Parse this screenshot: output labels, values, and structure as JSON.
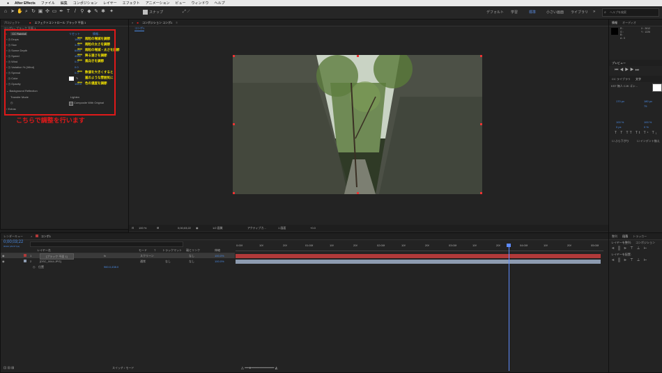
{
  "menubar": {
    "app_name": "After Effects",
    "items": [
      "ファイル",
      "編集",
      "コンポジション",
      "レイヤー",
      "エフェクト",
      "アニメーション",
      "ビュー",
      "ウィンドウ",
      "ヘルプ"
    ]
  },
  "toolbar": {
    "snap_label": "スナップ",
    "workspaces": [
      "デフォルト",
      "学習",
      "標準",
      "小さい画面",
      "ライブラリ"
    ],
    "active_workspace": "標準",
    "help_search_placeholder": "ヘルプを検索"
  },
  "effect_panel": {
    "tabs": [
      "プロジェクト",
      "エフェクトコントロール ブラック 平面 1"
    ],
    "breadcrumb": "コンポ1 • ブラック 平面 1",
    "effect_name": "CC Rainfall",
    "reset_label": "リセット",
    "properties": [
      {
        "label": "Drops",
        "value": "1600",
        "note": "雨粒の増減を調節"
      },
      {
        "label": "Size",
        "value": "3.00",
        "note": "雨粒の太さを調節"
      },
      {
        "label": "Scene Depth",
        "value": "6000",
        "note": "雨粒の増減・太さを調節"
      },
      {
        "label": "Speed",
        "value": "4000",
        "note": "降る速さを調節"
      },
      {
        "label": "Wind",
        "value": "0.0",
        "note": "風向きを調節"
      },
      {
        "label": "Variation % (Wind)",
        "value": "0.0",
        "note": ""
      },
      {
        "label": "Spread",
        "value": "0.0",
        "note": "数値を大きくすると"
      },
      {
        "label": "Color",
        "value": "",
        "note": "嵐のような雰囲気に"
      },
      {
        "label": "Opacity",
        "value": "100.0",
        "note": "色の濃度を調節"
      }
    ],
    "background_reflection": "Background Reflection",
    "transfer_mode_label": "Transfer Mode",
    "transfer_mode_value": "Lighten",
    "composite_label": "Composite With Original",
    "extras_label": "Extras",
    "instruction": "こちらで調整を行います"
  },
  "composition": {
    "tab": "コンポジション コンポ1",
    "sub_tab": "コンポ1",
    "zoom": "100 %",
    "timecode": "0;00;03;22",
    "resolution": "1/2 画質",
    "camera": "アクティブカ...",
    "views": "1 画面",
    "exposure": "+0.0"
  },
  "right_panels": {
    "info_tab": "情報",
    "audio_tab": "オーディオ",
    "info_values": [
      "R :",
      "G :",
      "B :",
      "A : 0",
      "X : 2612",
      "Y : 1226"
    ],
    "preview_tab": "プレビュー",
    "libraries_tab": "CC ライブラリ",
    "character_tab": "文字",
    "font_name": "KST 無人 CJK ゴシ...",
    "font_size": "170 px",
    "leading": "180 px",
    "tracking": "75",
    "scale_h": "100 %",
    "scale_v": "100 %",
    "baseline": "0 px",
    "tsume": "0 %",
    "hanging": "ぶら下がり",
    "auto_leading": "インデント揃え",
    "align_tab": "整列",
    "paragraph_tab": "段落",
    "tracker_tab": "トラッカー",
    "align_to_label": "レイヤーを整列:",
    "align_to_value": "コンポジション",
    "distribute_label": "レイヤーを配置:"
  },
  "timeline": {
    "tabs": [
      "レンダーキュー",
      "コンポ1"
    ],
    "timecode": "0;00;03;22",
    "frame_info": "00112 (29.97 fps)",
    "search_placeholder": "",
    "columns": [
      "レイヤー名",
      "モード",
      "T",
      "トラックマット",
      "親とリンク",
      "伸縮"
    ],
    "layers": [
      {
        "index": "1",
        "name": "[ブラック 平面 1]",
        "mode": "スクリーン",
        "matte": "",
        "parent": "なし",
        "stretch": "100.0%"
      },
      {
        "index": "2",
        "name": "[DSC_0044.JPG]",
        "mode": "通常",
        "matte": "なし",
        "parent": "なし",
        "stretch": "100.0%"
      }
    ],
    "position_label": "位置",
    "position_value": "960.0,438.0",
    "ruler": [
      "0:00f",
      "10f",
      "20f",
      "01:00f",
      "10f",
      "20f",
      "02:00f",
      "10f",
      "20f",
      "03:00f",
      "10f",
      "20f",
      "04:00f",
      "10f",
      "20f",
      "05:00f"
    ],
    "footer_toggle": "スイッチ / モード"
  },
  "colors": {
    "accent_blue": "#4b8ce7",
    "annotation_yellow": "#f5e400",
    "annotation_red": "#e01919",
    "layer_red": "#b13a3a",
    "layer_gray": "#8d9bb0"
  }
}
